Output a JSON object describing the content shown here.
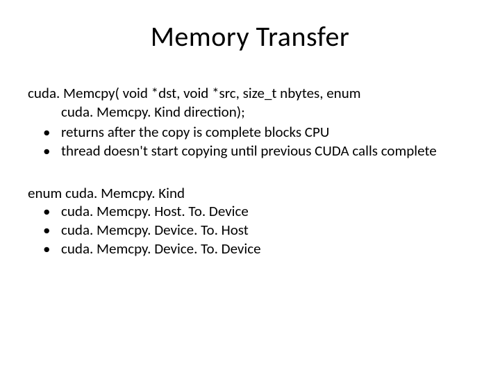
{
  "title": "Memory Transfer",
  "block1": {
    "line1": "cuda. Memcpy( void *dst,   void *src,   size_t nbytes,  enum",
    "line2": "cuda. Memcpy. Kind direction);",
    "bullets": [
      "returns after the copy is complete blocks CPU",
      "thread doesn't start copying until previous CUDA calls complete"
    ]
  },
  "block2": {
    "enum_line": "enum cuda. Memcpy. Kind",
    "bullets": [
      "cuda. Memcpy. Host. To. Device",
      "cuda. Memcpy. Device. To. Host",
      "cuda. Memcpy. Device. To. Device"
    ]
  }
}
